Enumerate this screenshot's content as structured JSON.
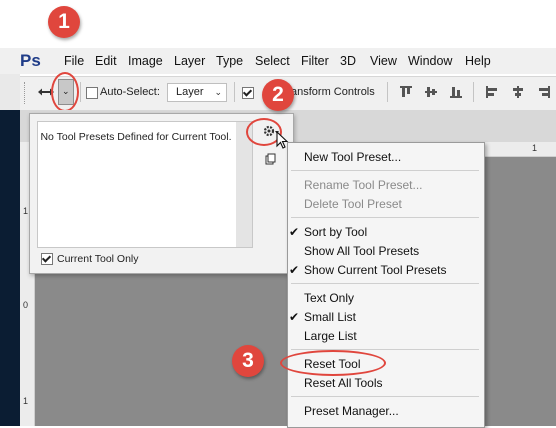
{
  "app": {
    "logo": "Ps",
    "menu": [
      "File",
      "Edit",
      "Image",
      "Layer",
      "Type",
      "Select",
      "Filter",
      "3D",
      "View",
      "Window",
      "Help"
    ]
  },
  "options": {
    "auto_select_label": "Auto-Select:",
    "auto_select_checked": false,
    "layer_value": "Layer",
    "transform_label": "ansform Controls",
    "transform_checked": true
  },
  "presets_panel": {
    "empty_message": "No Tool Presets Defined for Current Tool.",
    "current_tool_only_label": "Current Tool Only",
    "current_tool_only_checked": true
  },
  "context_menu": {
    "items": [
      {
        "label": "New Tool Preset...",
        "enabled": true,
        "checked": false
      },
      {
        "label": "Rename Tool Preset...",
        "enabled": false,
        "checked": false
      },
      {
        "label": "Delete Tool Preset",
        "enabled": false,
        "checked": false
      },
      {
        "label": "Sort by Tool",
        "enabled": true,
        "checked": true
      },
      {
        "label": "Show All Tool Presets",
        "enabled": true,
        "checked": false
      },
      {
        "label": "Show Current Tool Presets",
        "enabled": true,
        "checked": true
      },
      {
        "label": "Text Only",
        "enabled": true,
        "checked": false
      },
      {
        "label": "Small List",
        "enabled": true,
        "checked": true
      },
      {
        "label": "Large List",
        "enabled": true,
        "checked": false
      },
      {
        "label": "Reset Tool",
        "enabled": true,
        "checked": false
      },
      {
        "label": "Reset All Tools",
        "enabled": true,
        "checked": false
      },
      {
        "label": "Preset Manager...",
        "enabled": true,
        "checked": false
      }
    ]
  },
  "rulers": {
    "top_tick": "1",
    "left_ticks": [
      "1",
      "0",
      "1"
    ]
  },
  "callouts": [
    "1",
    "2",
    "3"
  ],
  "colors": {
    "callout": "#e0463d",
    "ps_logo": "#1f3c88",
    "canvas": "#8a8a8a"
  }
}
